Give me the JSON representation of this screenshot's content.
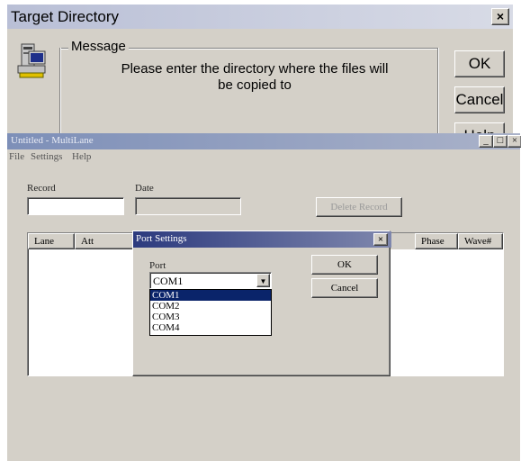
{
  "target_directory": {
    "title": "Target Directory",
    "close_glyph": "×",
    "group_label": "Message",
    "message": "Please enter the directory where the files will be copied to",
    "ok_label": "OK",
    "cancel_label": "Cancel",
    "help_label": "Help"
  },
  "multilane": {
    "title": "Untitled - MultiLane",
    "controls": {
      "minimize": "_",
      "maximize": "□",
      "close": "×"
    },
    "menu": [
      "File",
      "Settings",
      "Help"
    ],
    "record_label": "Record",
    "record_value": "",
    "date_label": "Date",
    "date_value": "",
    "delete_record_label": "Delete Record",
    "table": {
      "columns": [
        "Lane",
        "Att",
        "Phase",
        "Wave#"
      ]
    }
  },
  "port_settings": {
    "title": "Port Settings",
    "close_glyph": "×",
    "port_label": "Port",
    "selected_port": "COM1",
    "options": [
      "COM1",
      "COM2",
      "COM3",
      "COM4"
    ],
    "highlighted_index": 0,
    "ok_label": "OK",
    "cancel_label": "Cancel"
  },
  "colors": {
    "dialog_face": "#d4d0c8",
    "active_title": "#2c3a7e",
    "selection": "#0a246a"
  }
}
